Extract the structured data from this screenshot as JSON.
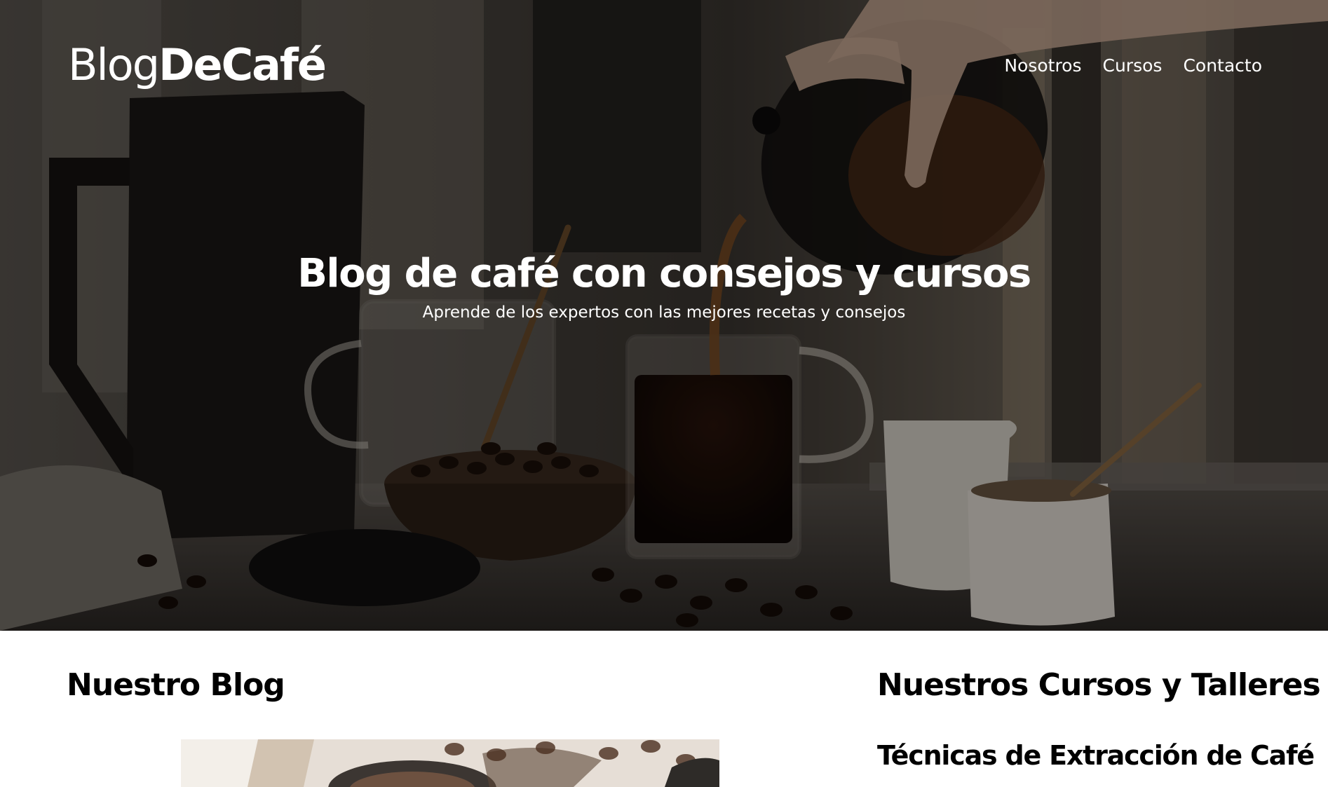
{
  "header": {
    "logo_light": "Blog",
    "logo_bold": "DeCafé",
    "nav": [
      {
        "label": "Nosotros"
      },
      {
        "label": "Cursos"
      },
      {
        "label": "Contacto"
      }
    ]
  },
  "hero": {
    "title": "Blog de café con consejos y cursos",
    "subtitle": "Aprende de los expertos con las mejores recetas y consejos"
  },
  "blog": {
    "heading": "Nuestro Blog"
  },
  "courses": {
    "heading": "Nuestros Cursos y Talleres",
    "items": [
      {
        "title": "Técnicas de Extracción de Café"
      }
    ]
  },
  "colors": {
    "hero_overlay": "#000000",
    "text_light": "#ffffff",
    "text_dark": "#000000",
    "background": "#ffffff"
  }
}
